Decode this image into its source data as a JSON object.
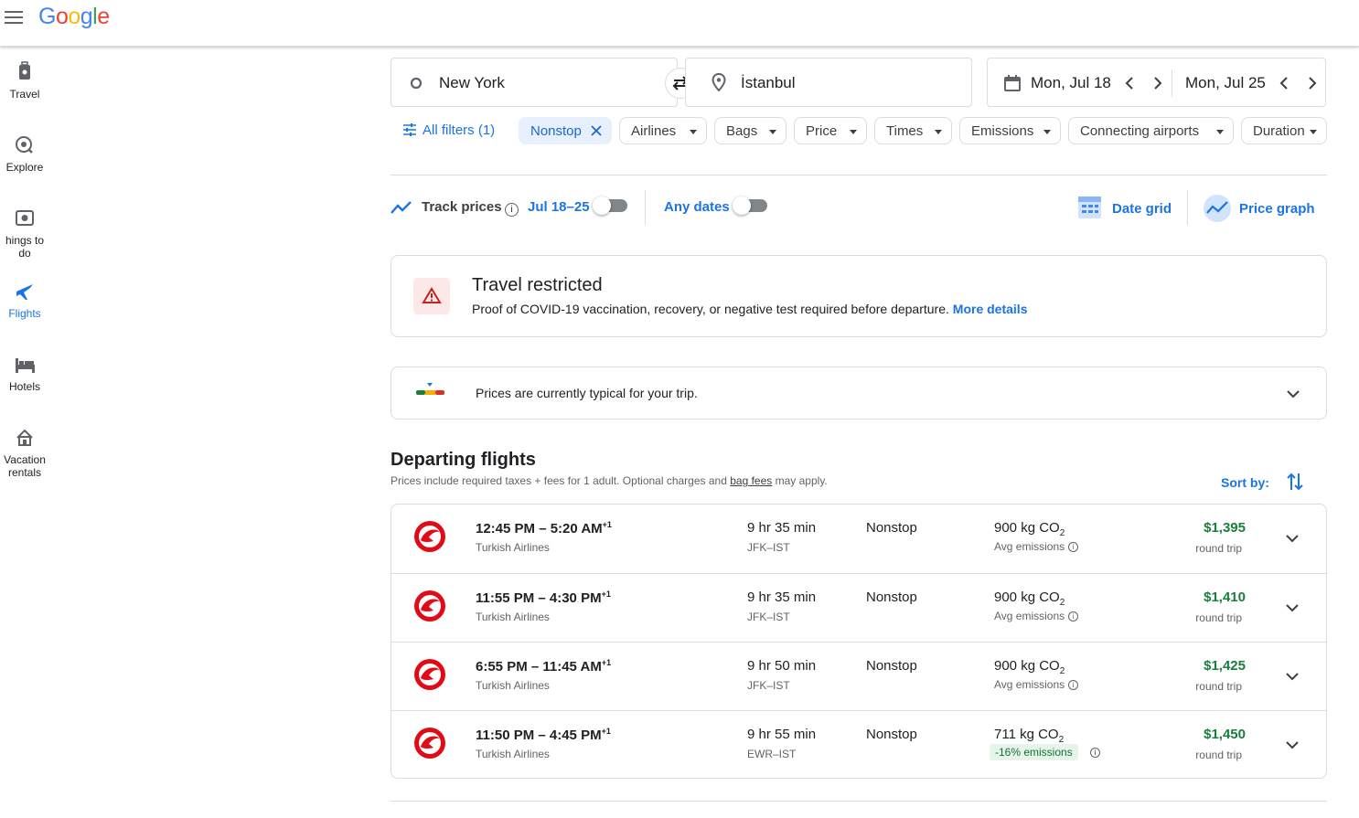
{
  "header": {
    "logo_text": "Google"
  },
  "sidenav": [
    {
      "label": "Travel",
      "icon": "suitcase-icon"
    },
    {
      "label": "Explore",
      "icon": "explore-icon"
    },
    {
      "label": "hings to do",
      "icon": "camera-icon"
    },
    {
      "label": "Flights",
      "icon": "airplane-icon",
      "active": true
    },
    {
      "label": "Hotels",
      "icon": "bed-icon"
    },
    {
      "label": "Vacation rentals",
      "icon": "house-icon"
    }
  ],
  "search": {
    "origin": "New York",
    "destination": "İstanbul",
    "depart_date": "Mon, Jul 18",
    "return_date": "Mon, Jul 25"
  },
  "filters": {
    "all_filters": "All filters (1)",
    "chips": [
      "Nonstop",
      "Airlines",
      "Bags",
      "Price",
      "Times",
      "Emissions",
      "Connecting airports",
      "Duration"
    ]
  },
  "tracking": {
    "track_prices": "Track prices",
    "date_range": "Jul 18–25",
    "any_dates": "Any dates",
    "date_grid": "Date grid",
    "price_graph": "Price graph"
  },
  "alert": {
    "title": "Travel restricted",
    "body": "Proof of COVID-19 vaccination, recovery, or negative test required before departure.",
    "link": "More details"
  },
  "price_insight": {
    "text": "Prices are currently typical for your trip."
  },
  "results": {
    "heading": "Departing flights",
    "note_prefix": "Prices include required taxes + fees for 1 adult. Optional charges and",
    "note_link": "bag fees",
    "note_suffix": "may apply.",
    "sort_label": "Sort by:",
    "flights": [
      {
        "times": "12:45 PM – 5:20 AM",
        "plus": "+1",
        "airline": "Turkish Airlines",
        "duration": "9 hr 35 min",
        "route": "JFK–IST",
        "stops": "Nonstop",
        "emissions": "900 kg CO",
        "em_note": "Avg emissions",
        "price": "$1,395",
        "price_type": "round trip"
      },
      {
        "times": "11:55 PM – 4:30 PM",
        "plus": "+1",
        "airline": "Turkish Airlines",
        "duration": "9 hr 35 min",
        "route": "JFK–IST",
        "stops": "Nonstop",
        "emissions": "900 kg CO",
        "em_note": "Avg emissions",
        "price": "$1,410",
        "price_type": "round trip"
      },
      {
        "times": "6:55 PM – 11:45 AM",
        "plus": "+1",
        "airline": "Turkish Airlines",
        "duration": "9 hr 50 min",
        "route": "JFK–IST",
        "stops": "Nonstop",
        "emissions": "900 kg CO",
        "em_note": "Avg emissions",
        "price": "$1,425",
        "price_type": "round trip"
      },
      {
        "times": "11:50 PM – 4:45 PM",
        "plus": "+1",
        "airline": "Turkish Airlines",
        "duration": "9 hr 55 min",
        "route": "EWR–IST",
        "stops": "Nonstop",
        "emissions": "711 kg CO",
        "em_note": "-16% emissions",
        "price": "$1,450",
        "price_type": "round trip"
      }
    ]
  },
  "colors": {
    "accent": "#1a73e8",
    "price": "#188038",
    "airline_red": "#e30a17"
  }
}
